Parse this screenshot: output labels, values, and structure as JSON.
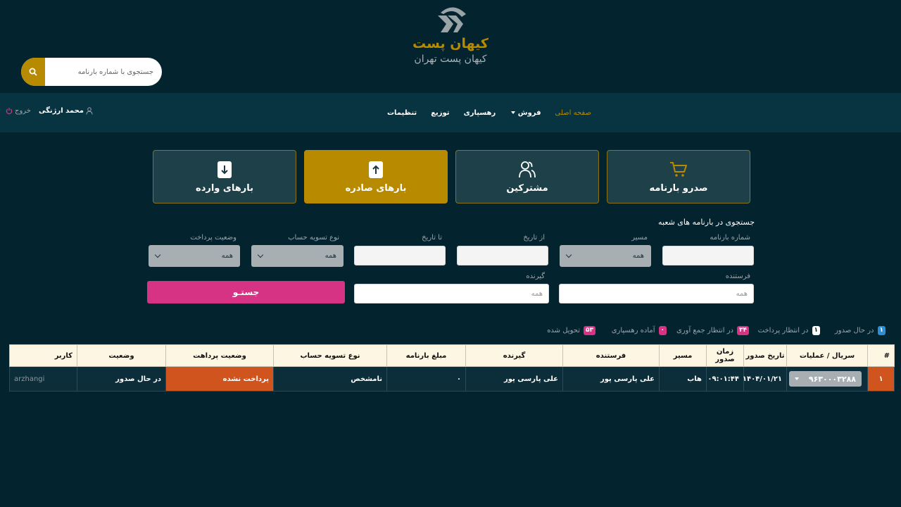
{
  "brand": {
    "name": "کیهان پست",
    "subtitle": "کیهان پست تهران"
  },
  "search": {
    "placeholder": "جستجوی با شماره بارنامه"
  },
  "nav": {
    "items": [
      "صفحه اصلی",
      "فروش",
      "رهسپاری",
      "توزیع",
      "تنظیمات"
    ],
    "user": "محمد ارژنگی",
    "logout": "خروج"
  },
  "tiles": [
    {
      "label": "صدرو بارنامه",
      "icon": "cart-icon"
    },
    {
      "label": "مشترکین",
      "icon": "users-icon"
    },
    {
      "label": "بارهای صادره",
      "icon": "arrow-up-icon"
    },
    {
      "label": "بارهای وارده",
      "icon": "arrow-down-icon"
    }
  ],
  "form": {
    "title": "جستجوی در بارنامه های شعبه",
    "waybill_label": "شماره بارنامه",
    "route_label": "مسیر",
    "route_value": "همه",
    "from_label": "از تاریخ",
    "to_label": "تا تاریخ",
    "settlement_label": "نوع تسویه حساب",
    "settlement_value": "همه",
    "payment_label": "وضعیت پرداخت",
    "payment_value": "همه",
    "sender_label": "فرستنده",
    "sender_placeholder": "همه",
    "receiver_label": "گیرنده",
    "receiver_placeholder": "همه",
    "search_button": "جستـو"
  },
  "legend": [
    {
      "label": "در حال صدور",
      "count": "۱",
      "color": "#2c8fd6"
    },
    {
      "label": "در انتظار پرداخت",
      "count": "۱",
      "color": "#ffffff"
    },
    {
      "label": "در انتظار جمع آوری",
      "count": "۳۴",
      "color": "#d63384"
    },
    {
      "label": "آماده رهسپاری",
      "count": "۰",
      "color": "#d63384"
    },
    {
      "label": "تحویل شده",
      "count": "۵۳",
      "color": "#d63384"
    }
  ],
  "table": {
    "headers": [
      "#",
      "سریال / عملیات",
      "تاریخ صدور",
      "زمان صدور",
      "مسیر",
      "فرستنده",
      "گیرنده",
      "مبلغ بارنامه",
      "نوع تسویه حساب",
      "وضعیت پرداهت",
      "وضعیت",
      "کاربر"
    ],
    "rows": [
      {
        "index": "۱",
        "serial": "۹۶۳۰۰۰۳۲۸۸",
        "date": "۱۴۰۴/۰۱/۲۱",
        "time": "۰۹:۰۱:۴۴",
        "route": "هاب",
        "sender": "علی پارسی پور",
        "receiver": "علی پارسی پور",
        "amount": "۰",
        "settlement": "نامشخص",
        "payment_status": "پرداخت نشده",
        "status": "در حال صدور",
        "user": "arzhangi"
      }
    ]
  },
  "colors": {
    "background": "#03232f",
    "navbar": "#073440",
    "accent": "#b88a00",
    "pink": "#d63384",
    "orange": "#d0541e"
  }
}
